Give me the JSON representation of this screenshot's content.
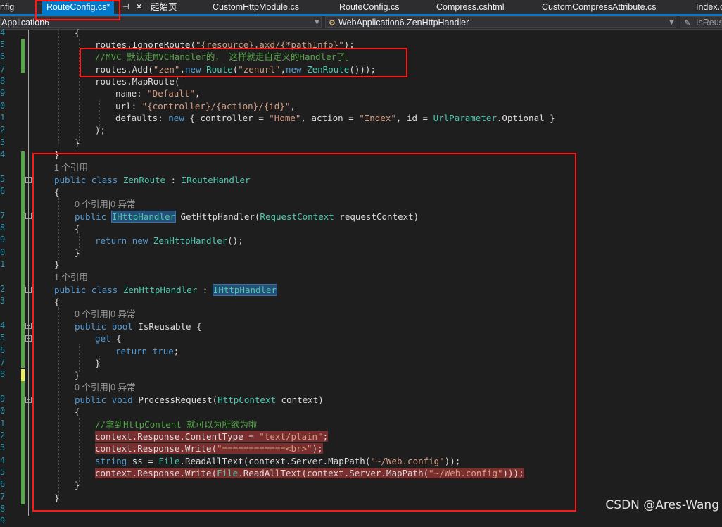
{
  "tabs": [
    {
      "label": "nfig",
      "active": false
    },
    {
      "label": "RouteConfig.cs*",
      "active": true
    },
    {
      "label": "起始页",
      "active": false
    },
    {
      "label": "CustomHttpModule.cs",
      "active": false
    },
    {
      "label": "RouteConfig.cs",
      "active": false
    },
    {
      "label": "Compress.cshtml",
      "active": false
    },
    {
      "label": "CustomCompressAttribute.cs",
      "active": false
    },
    {
      "label": "Index.c",
      "active": false
    }
  ],
  "navbar": {
    "project": "Application6",
    "type": "WebApplication6.ZenHttpHandler",
    "member": "IsReusa"
  },
  "line_numbers": [
    "4",
    "5",
    "6",
    "7",
    "8",
    "9",
    "0",
    "1",
    "2",
    "3",
    "4",
    "5",
    "6",
    "7",
    "8",
    "9",
    "0",
    "1",
    "2",
    "3",
    "4",
    "5",
    "6",
    "7",
    "8",
    "9",
    "0",
    "1",
    "2",
    "3",
    "4",
    "5",
    "6",
    "7",
    "8",
    "9"
  ],
  "codelens": {
    "ref1": "1 个引用",
    "ref0_exc": "0 个引用|0 异常"
  },
  "code": {
    "l04": "{",
    "l05": {
      "a": "routes.IgnoreRoute(",
      "b": "\"{resource}.axd/{*pathInfo}\"",
      "c": ");"
    },
    "l06": "//MVC 默认走MVCHandler的， 这样就走自定义的Handler了。",
    "l07": {
      "a": "routes.Add(",
      "b": "\"zen\"",
      "c": ",",
      "d": "new",
      "e": " ",
      "f": "Route",
      "g": "(",
      "h": "\"zenurl\"",
      "i": ",",
      "j": "new",
      "k": " ",
      "l": "ZenRoute",
      "m": "()));"
    },
    "l08": "routes.MapRoute(",
    "l09": {
      "a": "name: ",
      "b": "\"Default\"",
      "c": ","
    },
    "l10": {
      "a": "url: ",
      "b": "\"{controller}/{action}/{id}\"",
      "c": ","
    },
    "l11": {
      "a": "defaults: ",
      "b": "new",
      "c": " { controller = ",
      "d": "\"Home\"",
      "e": ", action = ",
      "f": "\"Index\"",
      "g": ", id = ",
      "h": "UrlParameter",
      "i": ".Optional }"
    },
    "l12": ");",
    "l13": "}",
    "l14": "}",
    "l15": {
      "a": "public",
      "b": " ",
      "c": "class",
      "d": " ",
      "e": "ZenRoute",
      "f": " : ",
      "g": "IRouteHandler"
    },
    "l16": "{",
    "l17": {
      "a": "public",
      "b": " ",
      "c": "IHttpHandler",
      "d": " GetHttpHandler(",
      "e": "RequestContext",
      "f": " requestContext)"
    },
    "l18": "{",
    "l19": {
      "a": "return",
      "b": " ",
      "c": "new",
      "d": " ",
      "e": "ZenHttpHandler",
      "f": "();"
    },
    "l20": "}",
    "l21": "}",
    "l22": {
      "a": "public",
      "b": " ",
      "c": "class",
      "d": " ",
      "e": "ZenHttpHandler",
      "f": " : ",
      "g": "IHttpHandler"
    },
    "l23": "{",
    "l24": {
      "a": "public",
      "b": " ",
      "c": "bool",
      "d": " IsReusable {"
    },
    "l25": {
      "a": "get",
      "b": " {"
    },
    "l26": {
      "a": "return",
      "b": " ",
      "c": "true",
      "d": ";"
    },
    "l27": "}",
    "l28": "}",
    "l29": {
      "a": "public",
      "b": " ",
      "c": "void",
      "d": " ProcessRequest(",
      "e": "HttpContext",
      "f": " context)"
    },
    "l30": "{",
    "l31": "//拿到HttpContent 就可以为所欲为啦",
    "l32": {
      "a": "context.Response.ContentType = ",
      "b": "\"text/plain\"",
      "c": ";"
    },
    "l33": {
      "a": "context.Response.Write(",
      "b": "\"============<br>\"",
      "c": ");"
    },
    "l34": {
      "a": "string",
      "b": " ss = ",
      "c": "File",
      "d": ".ReadAllText(context.Server.MapPath(",
      "e": "\"~/Web.config\"",
      "f": "));"
    },
    "l35": {
      "a": "context.Response.Write(",
      "b": "File",
      "c": ".ReadAllText(context.Server.MapPath(",
      "d": "\"~/Web.config\"",
      "e": ")));"
    },
    "l36": "}",
    "l37": "}"
  },
  "watermark": "CSDN @Ares-Wang",
  "colors": {
    "background": "#1e1e1e",
    "keyword": "#569cd6",
    "type": "#4ec9b0",
    "string": "#d69d85",
    "comment": "#57a64a",
    "highlight_box": "#ff1a1a",
    "tab_active": "#007acc"
  }
}
